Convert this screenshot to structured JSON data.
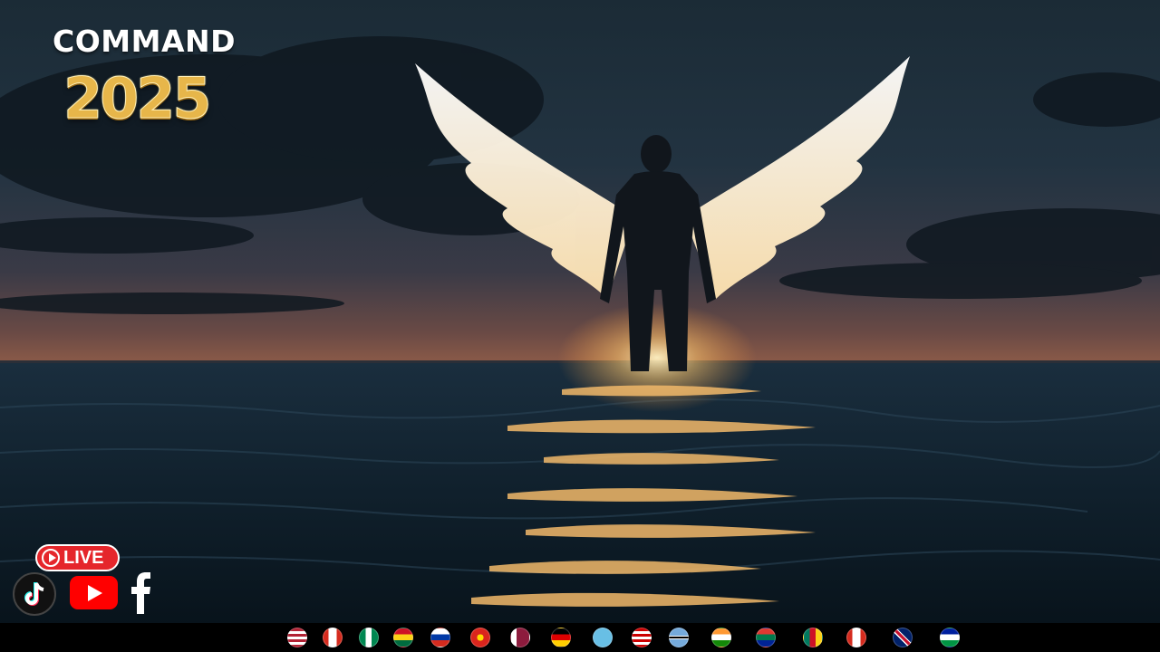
{
  "overlay": {
    "title_word": "COMMAND",
    "title_year": "2025"
  },
  "live": {
    "label": "LIVE"
  },
  "social_icons": [
    "tiktok-icon",
    "youtube-icon",
    "facebook-icon"
  ],
  "flags": [
    {
      "name": "flag-usa-icon"
    },
    {
      "name": "flag-canada-icon"
    },
    {
      "name": "flag-nigeria-icon"
    },
    {
      "name": "flag-ghana-icon"
    },
    {
      "name": "flag-russia-icon"
    },
    {
      "name": "flag-vietnam-icon"
    },
    {
      "name": "flag-qatar-icon"
    },
    {
      "name": "flag-germany-icon"
    },
    {
      "name": "flag-fiji-icon"
    },
    {
      "name": "flag-malaysia-icon"
    },
    {
      "name": "flag-botswana-icon"
    },
    {
      "name": "flag-india-icon"
    },
    {
      "name": "flag-south-africa-icon"
    },
    {
      "name": "flag-cameroon-icon"
    },
    {
      "name": "flag-canada-2-icon"
    },
    {
      "name": "flag-uk-icon"
    },
    {
      "name": "flag-lesotho-icon"
    }
  ],
  "colors": {
    "live_red": "#e5262b",
    "youtube_red": "#ff0000",
    "gold": "#e7b64a",
    "sky_dark": "#1a2a36",
    "sunset": "#7a4a3e"
  }
}
